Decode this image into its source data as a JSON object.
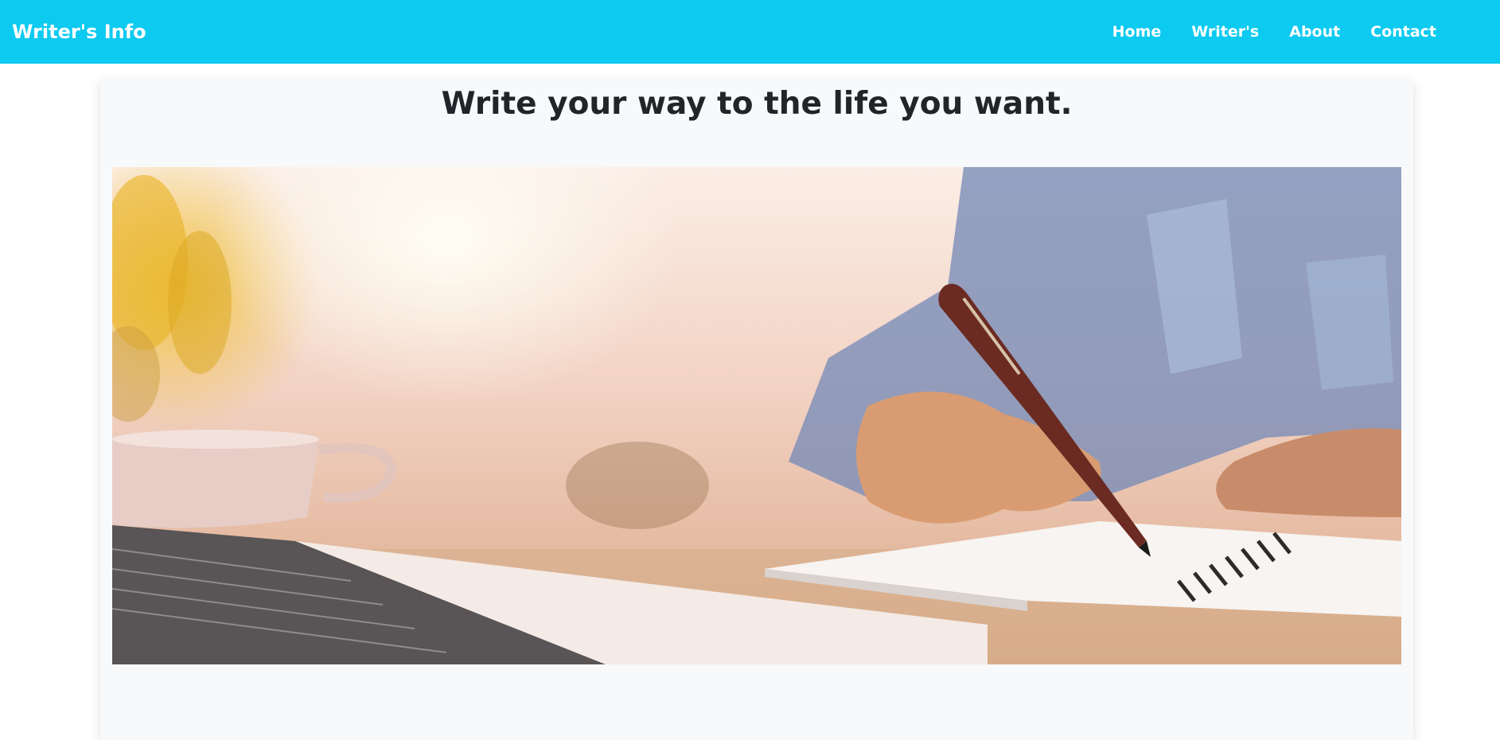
{
  "navbar": {
    "brand": "Writer's Info",
    "links": [
      "Home",
      "Writer's",
      "About",
      "Contact"
    ]
  },
  "main": {
    "headline": "Write your way to the life you want."
  },
  "colors": {
    "navbar_bg": "#0dcaf0",
    "card_bg": "#f8f9fa",
    "text_dark": "#212529"
  }
}
